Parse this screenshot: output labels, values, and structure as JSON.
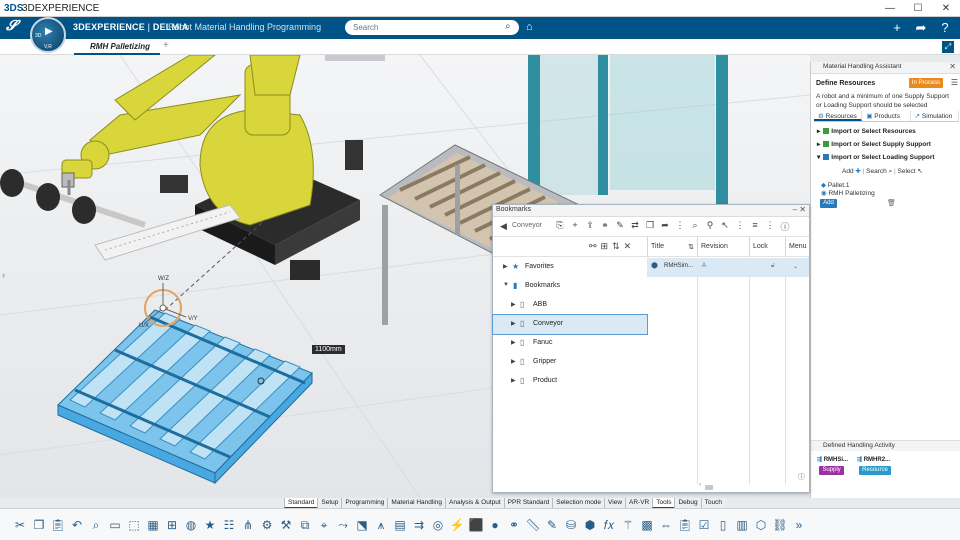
{
  "window": {
    "title": "3DEXPERIENCE",
    "controls": [
      "—",
      "☐",
      "✕"
    ]
  },
  "topbar": {
    "brand_bold": "3DEXPERIENCE",
    "brand_sep": " | ",
    "brand_light": "DELMIA",
    "app_name": "Robot Material Handling Programming",
    "search_placeholder": "Search",
    "compass_labels": {
      "left": "3D",
      "bottom": "V,R"
    }
  },
  "tabs": {
    "active": "RMH Palletizing",
    "add": "+"
  },
  "viewport": {
    "dimension_label": "1100mm",
    "axis_labels": {
      "w": "W/Z",
      "u": "U/X",
      "v": "V/Y"
    }
  },
  "bookmarks": {
    "title": "Bookmarks",
    "path": "Conveyor",
    "columns": [
      "Title",
      "Revision",
      "Lock",
      "Menu"
    ],
    "tree": [
      {
        "label": "Favorites",
        "icon": "star-icon",
        "level": 0,
        "expanded": false
      },
      {
        "label": "Bookmarks",
        "icon": "bookmark-icon",
        "level": 0,
        "expanded": true
      },
      {
        "label": "ABB",
        "icon": "bookmark-icon",
        "level": 1,
        "expanded": false
      },
      {
        "label": "Conveyor",
        "icon": "bookmark-icon",
        "level": 1,
        "expanded": false,
        "selected": true
      },
      {
        "label": "Fanuc",
        "icon": "bookmark-icon",
        "level": 1,
        "expanded": false
      },
      {
        "label": "Gripper",
        "icon": "bookmark-icon",
        "level": 1,
        "expanded": false
      },
      {
        "label": "Product",
        "icon": "bookmark-icon",
        "level": 1,
        "expanded": false
      }
    ],
    "row": {
      "title": "RMHSim...",
      "revision": "A"
    }
  },
  "assistant": {
    "title": "Material Handling Assistant",
    "step": "Define Resources",
    "status": "In Process",
    "description": "A robot and a minimum of one Supply Support or Loading Support should be selected",
    "tabs": [
      "Resources",
      "Products",
      "Simulation"
    ],
    "sections": [
      "Import or Select Resources",
      "Import or Select Supply Support",
      "Import or Select Loading Support"
    ],
    "actions": {
      "add": "Add",
      "search": "Search",
      "select": "Select"
    },
    "list": [
      "Pallet.1",
      "RMH Palletizing"
    ],
    "add_button": "Add",
    "activity_title": "Defined Handling Activity",
    "activities": [
      {
        "name": "RMHSi...",
        "tag": "Supply",
        "color": "#9b2fa6"
      },
      {
        "name": "RMHR2...",
        "tag": "Resource",
        "color": "#2a9bc9"
      }
    ]
  },
  "section_tabs": [
    "Standard",
    "Setup",
    "Programming",
    "Material Handling",
    "Analysis & Output",
    "PPR Standard",
    "Selection mode",
    "View",
    "AR-VR",
    "Tools",
    "Debug",
    "Touch"
  ],
  "active_section_tab": "Tools",
  "colors": {
    "brand": "#005386",
    "in_process": "#e88b1f",
    "selection": "#4aa8e0",
    "robot": "#d8d63a"
  }
}
